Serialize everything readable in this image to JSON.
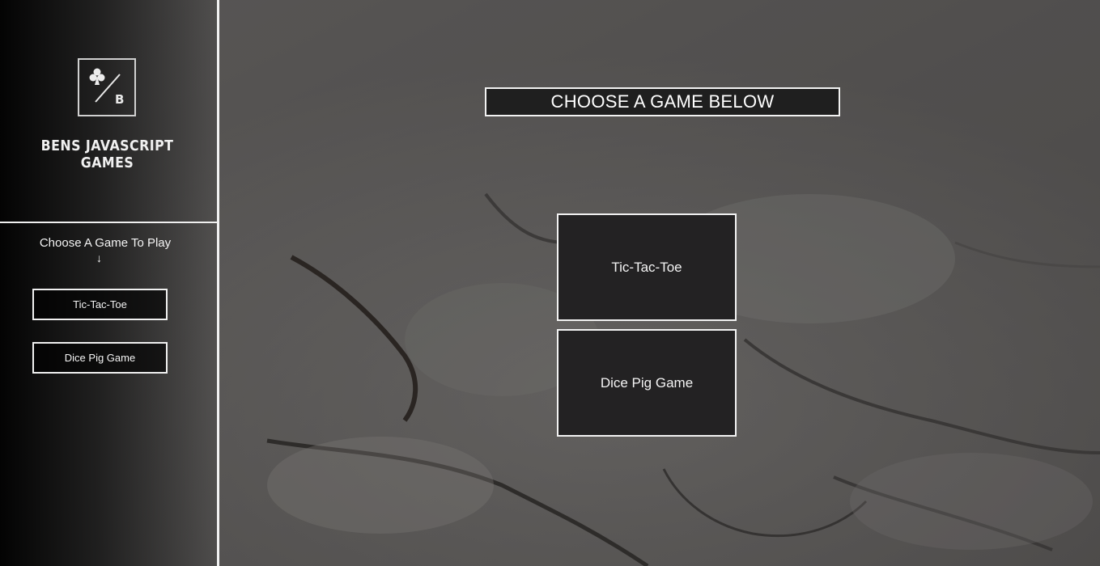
{
  "sidebar": {
    "logo": {
      "suit_icon": "club-icon",
      "letter": "B"
    },
    "brand": "BENS JAVASCRIPT GAMES",
    "heading": "Choose A Game To Play",
    "arrow": "↓",
    "items": [
      {
        "label": "Tic-Tac-Toe"
      },
      {
        "label": "Dice Pig Game"
      }
    ]
  },
  "main": {
    "title": "CHOOSE A GAME BELOW",
    "games": [
      {
        "label": "Tic-Tac-Toe"
      },
      {
        "label": "Dice Pig Game"
      }
    ]
  },
  "colors": {
    "panel": "#232223",
    "border": "#f2f2f2",
    "text": "#f4f4f4"
  }
}
